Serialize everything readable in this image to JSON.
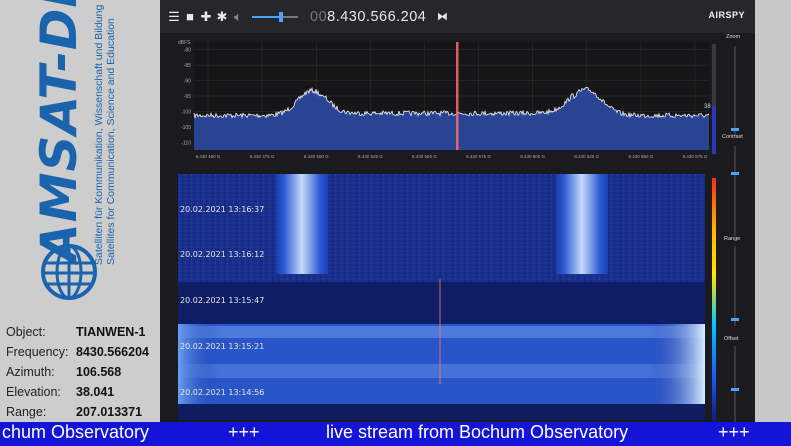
{
  "logo": {
    "word": "AMSAT-DL",
    "subtitle_de": "Satelliten für Kommunikation, Wissenschaft und Bildung",
    "subtitle_en": "Satellites for Communication, Science and Education",
    "icon": "globe-icon"
  },
  "sat_info": [
    {
      "label": "Object:",
      "value": "TIANWEN-1"
    },
    {
      "label": "Frequency:",
      "value": "8430.566204"
    },
    {
      "label": "Azimuth:",
      "value": "106.568"
    },
    {
      "label": "Elevation:",
      "value": "38.041"
    },
    {
      "label": "Range:",
      "value": "207.013371"
    }
  ],
  "toolbar": {
    "icons": [
      "menu-icon",
      "stop-icon",
      "add-icon",
      "settings-icon",
      "mute-icon"
    ],
    "volume_level": 0.62,
    "frequency_dim": "00",
    "frequency_main": "8.430.566.204",
    "swap_icon": "bowtie-icon",
    "brand": "AIRSPY"
  },
  "spectrum": {
    "unit": "dBFS",
    "y_ticks": [
      "-80",
      "-85",
      "-90",
      "-95",
      "-100",
      "-105",
      "-110"
    ],
    "x_ticks": [
      "8.430 450 G",
      "8.430 475 G",
      "8.430 500 G",
      "8.430 525 G",
      "8.430 550 G",
      "8.430 575 G",
      "8.430 600 G",
      "8.430 625 G",
      "8.430 650 G",
      "8.430 675 G"
    ],
    "colors": {
      "trace": "#f4f4f4",
      "fill": "#2b4ca8",
      "marker": "#ff6b6b"
    }
  },
  "waterfall": {
    "timestamps": [
      "20.02.2021 13:16:37",
      "20.02.2021 13:16:12",
      "20.02.2021 13:15:47",
      "20.02.2021 13:15:21",
      "20.02.2021 13:14:56"
    ]
  },
  "sidebar": {
    "labels": [
      "Zoom",
      "Contrast",
      "Range",
      "Offset"
    ],
    "level_readout": "38"
  },
  "ticker": {
    "segments": [
      "chum Observatory",
      "+++",
      "live stream from Bochum Observatory",
      "+++"
    ]
  }
}
